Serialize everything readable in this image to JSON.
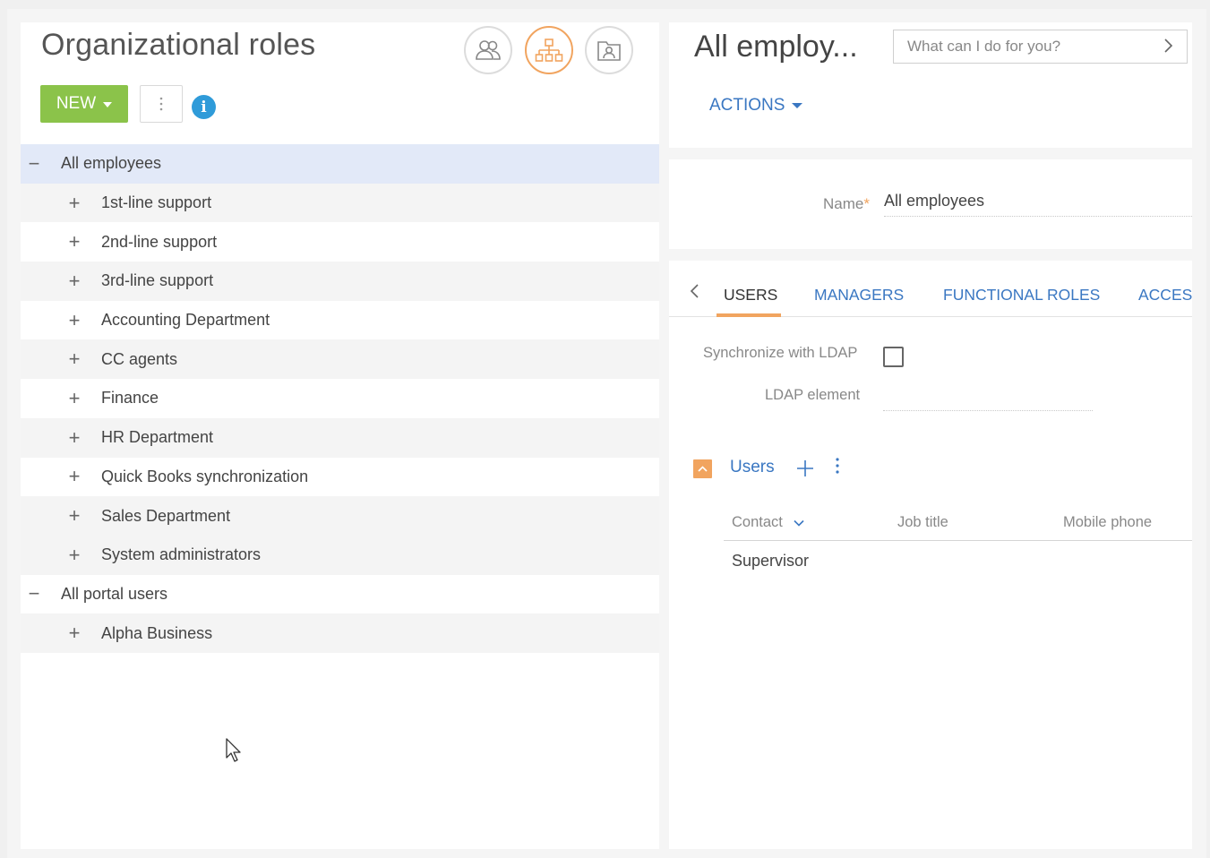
{
  "left_panel": {
    "title": "Organizational roles",
    "view_buttons": [
      {
        "icon": "users-icon",
        "active": false
      },
      {
        "icon": "org-chart-icon",
        "active": true
      },
      {
        "icon": "contact-card-icon",
        "active": false
      }
    ],
    "new_label": "NEW",
    "more_icon": "vertical-dots-icon",
    "info_icon": "info-icon"
  },
  "tree": {
    "root1": {
      "label": "All employees",
      "toggle": "−"
    },
    "items": [
      "1st-line support",
      "2nd-line support",
      "3rd-line support",
      "Accounting Department",
      "CC agents",
      "Finance",
      "HR Department",
      "Quick Books synchronization",
      "Sales Department",
      "System administrators"
    ],
    "root2": {
      "label": "All portal users",
      "toggle": "−"
    },
    "items2": [
      "Alpha Business"
    ],
    "child_toggle": "+"
  },
  "right_header": {
    "title": "All employ...",
    "search_placeholder": "What can I do for you?",
    "actions_label": "ACTIONS"
  },
  "record": {
    "name_label": "Name",
    "required_mark": "*",
    "name_value": "All employees"
  },
  "tabs": [
    "USERS",
    "MANAGERS",
    "FUNCTIONAL ROLES",
    "ACCESS"
  ],
  "ldap": {
    "sync_label": "Synchronize with LDAP",
    "sync_checked": false,
    "element_label": "LDAP element",
    "element_value": ""
  },
  "users_detail": {
    "title": "Users",
    "add_icon": "plus-icon",
    "more_icon": "vertical-dots-icon",
    "columns": [
      "Contact",
      "Job title",
      "Mobile phone"
    ],
    "rows": [
      [
        "Supervisor",
        "",
        ""
      ]
    ]
  },
  "colors": {
    "accent_orange": "#f1a45f",
    "new_green": "#8bc34a",
    "link_blue": "#3a77c2",
    "info_blue": "#2f9bd9",
    "selected_row": "#e2e9f8"
  }
}
